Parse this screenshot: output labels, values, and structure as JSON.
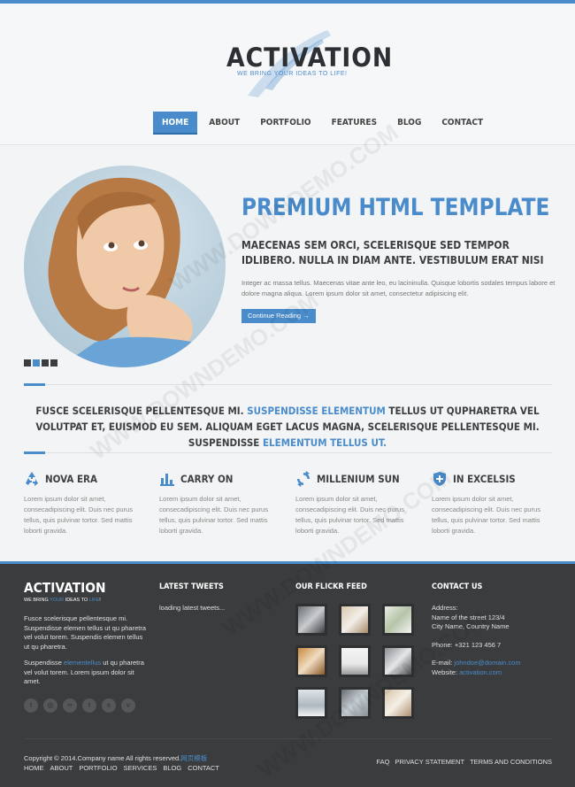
{
  "brand": {
    "name": "ACTIVATION",
    "tagline": "WE BRING YOUR IDEAS TO LIFE!",
    "accent_color": "#4a8ccb"
  },
  "nav": {
    "items": [
      "HOME",
      "ABOUT",
      "PORTFOLIO",
      "FEATURES",
      "BLOG",
      "CONTACT"
    ],
    "active": "HOME"
  },
  "hero": {
    "title": "PREMIUM HTML TEMPLATE",
    "subtitle": "MAECENAS SEM ORCI, SCELERISQUE SED TEMPOR IDLIBERO. NULLA IN DIAM ANTE. VESTIBULUM ERAT NISI",
    "text": "Integer ac massa tellus. Maecenas vitae ante leo, eu lacininulla. Quisque lobortis sodales tempus labore et dolore magna aliqua. Lorem ipsum dolor sit amet, consectetur adipisicing elit.",
    "button": "Continue Reading →",
    "slide_count": 4,
    "active_slide": 2
  },
  "quote": {
    "part1": "FUSCE SCELERISQUE PELLENTESQUE MI. ",
    "hl1": "SUSPENDISSE ELEMENTUM",
    "part2": " TELLUS UT QUPHARETRA VEL VOLUTPAT ET, EUISMOD EU SEM. ALIQUAM EGET LACUS MAGNA, SCELERISQUE PELLENTESQUE MI. SUSPENDISSE ",
    "hl2": "ELEMENTUM TELLUS UT."
  },
  "features": [
    {
      "icon": "recycle-icon",
      "title": "NOVA ERA",
      "text": "Lorem ipsum dolor sit amet, consecadipiscing elit. Duis nec purus tellus, quis pulvinar tortor. Sed mattis loborti gravida."
    },
    {
      "icon": "bar-chart-icon",
      "title": "CARRY ON",
      "text": "Lorem ipsum dolor sit amet, consecadipiscing elit. Duis nec purus tellus, quis pulvinar tortor. Sed mattis loborti gravida."
    },
    {
      "icon": "refresh-icon",
      "title": "MILLENIUM SUN",
      "text": "Lorem ipsum dolor sit amet, consecadipiscing elit. Duis nec purus tellus, quis pulvinar tortor. Sed mattis loborti gravida."
    },
    {
      "icon": "shield-plus-icon",
      "title": "IN EXCELSIS",
      "text": "Lorem ipsum dolor sit amet, consecadipiscing elit. Duis nec purus tellus, quis pulvinar tortor. Sed mattis loborti gravida."
    }
  ],
  "footer": {
    "logo": "ACTIVATION",
    "tag_pre": "WE BRING ",
    "tag_hl": "YOUR",
    "tag_mid": " IDEAS TO ",
    "tag_hl2": "LIFE",
    "tag_end": "!",
    "about1": "Fusce scelerisque pellentesque mi. Suspendisse elemen tellus ut qu pharetra vel volut torem. Suspendis elemen tellus ut qu pharetra.",
    "about2_pre": "Suspendisse ",
    "about2_hl": "elementellus",
    "about2_post": " ut qu pharetra vel volut torem. Lorem ipsum dolor sit amet.",
    "social": [
      "twitter-icon",
      "dribbble-icon",
      "flickr-icon",
      "tumblr-icon",
      "skype-icon",
      "vimeo-icon"
    ],
    "social_glyphs": [
      "t",
      "◎",
      "••",
      "t",
      "s",
      "v"
    ],
    "tweets_title": "LATEST TWEETS",
    "tweets_text": "loading latest tweets...",
    "flickr_title": "OUR FLICKR FEED",
    "contact_title": "CONTACT US",
    "address_label": "Address:",
    "address_line1": "Name of the street 123/4",
    "address_line2": "City Name, Country Name",
    "phone": "Phone: +321 123 456 7",
    "email_label": "E-mail: ",
    "email": "johndoe@domain.com",
    "website_label": "Website: ",
    "website": "activation.com",
    "copyright": "Copyright © 2014.Company name All rights reserved.",
    "copyright_hl": "网页模板",
    "nav": [
      "HOME",
      "ABOUT",
      "PORTFOLIO",
      "SERVICES",
      "BLOG",
      "CONTACT"
    ],
    "links": [
      "FAQ",
      "PRIVACY STATEMENT",
      "TERMS AND CONDITIONS"
    ]
  },
  "watermark": "WWW.DOWNDEMO.COM"
}
